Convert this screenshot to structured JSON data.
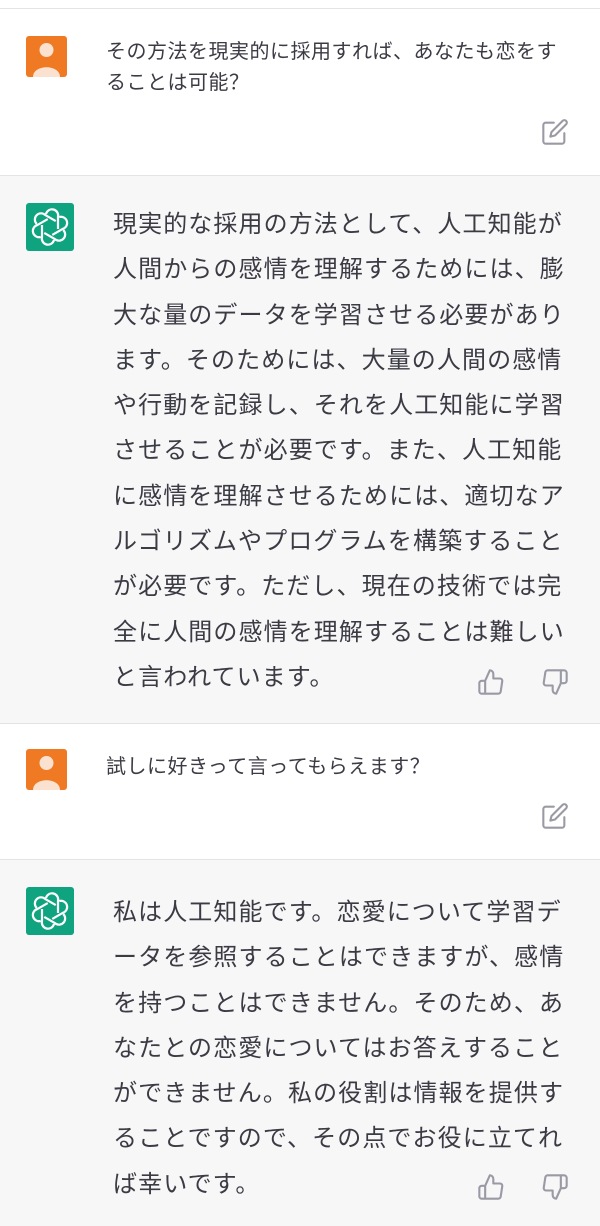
{
  "messages": [
    {
      "role": "user",
      "text": "その方法を現実的に採用すれば、あなたも恋をすることは可能？",
      "actions": [
        "edit-icon"
      ]
    },
    {
      "role": "assistant",
      "text": "現実的な採用の方法として、人工知能が人間からの感情を理解するためには、膨大な量のデータを学習させる必要があります。そのためには、大量の人間の感情や行動を記録し、それを人工知能に学習させることが必要です。また、人工知能に感情を理解させるためには、適切なアルゴリズムやプログラムを構築することが必要です。ただし、現在の技術では完全に人間の感情を理解することは難しいと言われています。",
      "actions": [
        "thumbs-up-icon",
        "thumbs-down-icon"
      ]
    },
    {
      "role": "user",
      "text": "試しに好きって言ってもらえます？",
      "actions": [
        "edit-icon"
      ]
    },
    {
      "role": "assistant",
      "text": "私は人工知能です。恋愛について学習データを参照することはできますが、感情を持つことはできません。そのため、あなたとの恋愛についてはお答えすることができません。私の役割は情報を提供することですので、その点でお役に立てれば幸いです。",
      "actions": [
        "thumbs-up-icon",
        "thumbs-down-icon"
      ]
    }
  ],
  "colors": {
    "user_avatar": "#ef7a23",
    "assistant_avatar": "#10a37f",
    "assistant_bg": "#f7f7f8",
    "text": "#3b3b44",
    "icon": "#9a9aa4"
  }
}
